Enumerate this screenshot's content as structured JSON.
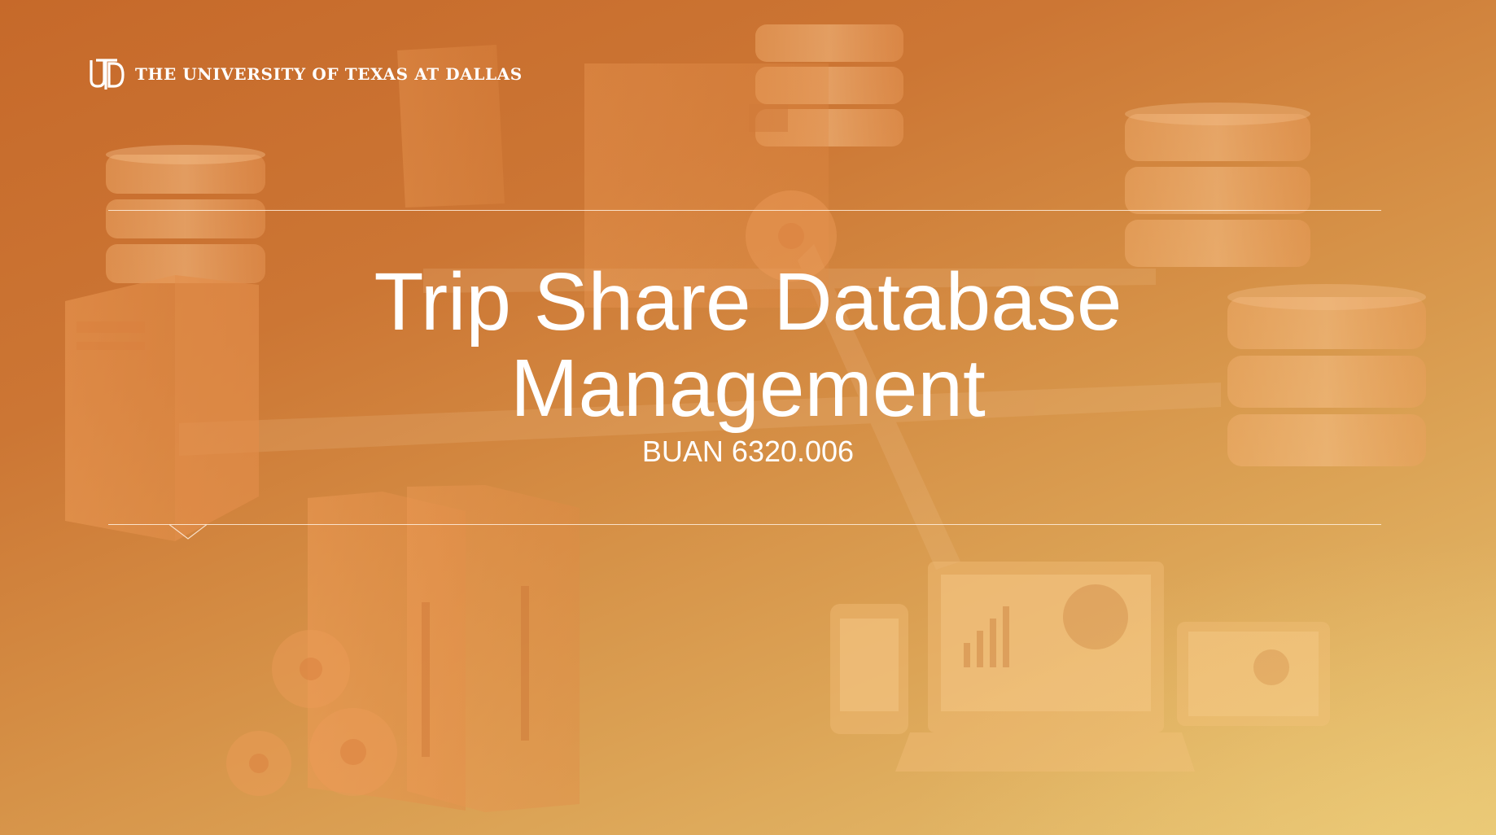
{
  "brand": {
    "monogram_icon": "utd-monogram-icon",
    "name": "THE UNIVERSITY OF TEXAS AT DALLAS"
  },
  "slide": {
    "title_line1": "Trip Share Database",
    "title_line2": "Management",
    "subtitle": "BUAN 6320.006"
  },
  "colors": {
    "background_start": "#c6692a",
    "background_end": "#e6c472",
    "text": "#ffffff"
  },
  "background_icons": [
    "database-icon",
    "server-tower-icon",
    "gear-icon",
    "laptop-chart-icon",
    "phone-chart-icon",
    "tablet-chart-icon"
  ]
}
